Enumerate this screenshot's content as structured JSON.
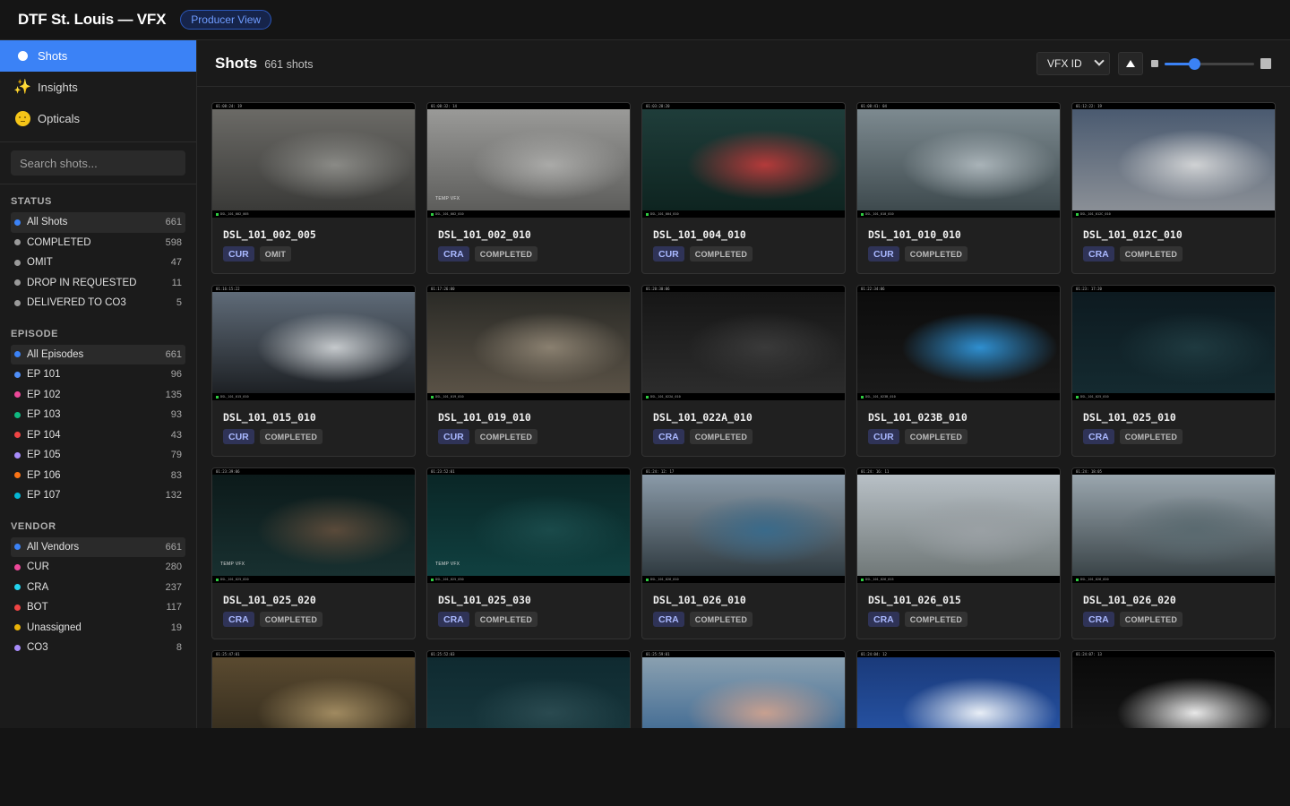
{
  "app": {
    "title": "DTF St. Louis — VFX",
    "view_badge": "Producer View"
  },
  "nav": [
    {
      "label": "Shots",
      "icon": "circle-icon",
      "active": true
    },
    {
      "label": "Insights",
      "icon": "sparkle-icon",
      "active": false
    },
    {
      "label": "Opticals",
      "icon": "face-icon",
      "active": false
    }
  ],
  "search": {
    "placeholder": "Search shots..."
  },
  "filters": {
    "status": {
      "title": "STATUS",
      "items": [
        {
          "label": "All Shots",
          "count": "661",
          "color": "#3b82f6",
          "selected": true
        },
        {
          "label": "COMPLETED",
          "count": "598",
          "color": "#9a9a9a"
        },
        {
          "label": "OMIT",
          "count": "47",
          "color": "#9a9a9a"
        },
        {
          "label": "DROP IN REQUESTED",
          "count": "11",
          "color": "#9a9a9a"
        },
        {
          "label": "DELIVERED TO CO3",
          "count": "5",
          "color": "#9a9a9a"
        }
      ]
    },
    "episode": {
      "title": "EPISODE",
      "items": [
        {
          "label": "All Episodes",
          "count": "661",
          "color": "#3b82f6",
          "selected": true
        },
        {
          "label": "EP 101",
          "count": "96",
          "color": "#4f8ef7"
        },
        {
          "label": "EP 102",
          "count": "135",
          "color": "#ec4899"
        },
        {
          "label": "EP 103",
          "count": "93",
          "color": "#10b981"
        },
        {
          "label": "EP 104",
          "count": "43",
          "color": "#ef4444"
        },
        {
          "label": "EP 105",
          "count": "79",
          "color": "#a78bfa"
        },
        {
          "label": "EP 106",
          "count": "83",
          "color": "#f97316"
        },
        {
          "label": "EP 107",
          "count": "132",
          "color": "#06b6d4"
        }
      ]
    },
    "vendor": {
      "title": "VENDOR",
      "items": [
        {
          "label": "All Vendors",
          "count": "661",
          "color": "#3b82f6",
          "selected": true
        },
        {
          "label": "CUR",
          "count": "280",
          "color": "#ec4899"
        },
        {
          "label": "CRA",
          "count": "237",
          "color": "#22d3ee"
        },
        {
          "label": "BOT",
          "count": "117",
          "color": "#ef4444"
        },
        {
          "label": "Unassigned",
          "count": "19",
          "color": "#eab308"
        },
        {
          "label": "CO3",
          "count": "8",
          "color": "#a78bfa"
        }
      ]
    }
  },
  "main": {
    "title": "Shots",
    "count_label": "661 shots",
    "sort": {
      "selected": "VFX ID"
    },
    "thumb_size": 0.33
  },
  "shots": [
    {
      "name": "DSL_101_002_005",
      "vendor": "CUR",
      "status": "OMIT",
      "tc": "01:08:24: 19",
      "bg": [
        "#6b6a66",
        "#3a3a38",
        "#8a8a86"
      ],
      "temp": false
    },
    {
      "name": "DSL_101_002_010",
      "vendor": "CRA",
      "status": "COMPLETED",
      "tc": "01:08:32: 14",
      "bg": [
        "#9a9a98",
        "#5d5d5b",
        "#aaaaa8"
      ],
      "temp": true
    },
    {
      "name": "DSL_101_004_010",
      "vendor": "CUR",
      "status": "COMPLETED",
      "tc": "01:03:28:20",
      "bg": [
        "#1f3d3a",
        "#0e2420",
        "#b43a3a"
      ],
      "temp": false
    },
    {
      "name": "DSL_101_010_010",
      "vendor": "CUR",
      "status": "COMPLETED",
      "tc": "01:08:41: 04",
      "bg": [
        "#7d8a90",
        "#3e4a4e",
        "#a9b3b8"
      ],
      "temp": false
    },
    {
      "name": "DSL_101_012C_010",
      "vendor": "CRA",
      "status": "COMPLETED",
      "tc": "01:12:22: 19",
      "bg": [
        "#4a5a70",
        "#8a8f96",
        "#d0d2d4"
      ],
      "temp": false
    },
    {
      "name": "DSL_101_015_010",
      "vendor": "CUR",
      "status": "COMPLETED",
      "tc": "01:16:15:22",
      "bg": [
        "#5f6b78",
        "#1d2024",
        "#c5c9cc"
      ],
      "temp": false
    },
    {
      "name": "DSL_101_019_010",
      "vendor": "CUR",
      "status": "COMPLETED",
      "tc": "01:17:26:00",
      "bg": [
        "#2a2a26",
        "#5a5246",
        "#8a8070"
      ],
      "temp": false
    },
    {
      "name": "DSL_101_022A_010",
      "vendor": "CRA",
      "status": "COMPLETED",
      "tc": "01:20:30:06",
      "bg": [
        "#161616",
        "#2c2c2c",
        "#3a3a3a"
      ],
      "temp": false
    },
    {
      "name": "DSL_101_023B_010",
      "vendor": "CUR",
      "status": "COMPLETED",
      "tc": "01:22:34:06",
      "bg": [
        "#0c0c0c",
        "#1a1a1a",
        "#2f8fd0"
      ],
      "temp": false
    },
    {
      "name": "DSL_101_025_010",
      "vendor": "CRA",
      "status": "COMPLETED",
      "tc": "01:23: 17:20",
      "bg": [
        "#0d1a20",
        "#142a30",
        "#1f3a40"
      ],
      "temp": false
    },
    {
      "name": "DSL_101_025_020",
      "vendor": "CRA",
      "status": "COMPLETED",
      "tc": "01:23:39:06",
      "bg": [
        "#0c1a1a",
        "#183030",
        "#5a4a3a"
      ],
      "temp": true
    },
    {
      "name": "DSL_101_025_030",
      "vendor": "CRA",
      "status": "COMPLETED",
      "tc": "01:23:52:01",
      "bg": [
        "#0a2626",
        "#104040",
        "#1a4a4a"
      ],
      "temp": true
    },
    {
      "name": "DSL_101_026_010",
      "vendor": "CRA",
      "status": "COMPLETED",
      "tc": "01:24: 12: 17",
      "bg": [
        "#8a9aa8",
        "#2f3a40",
        "#3a6a8a"
      ],
      "temp": false
    },
    {
      "name": "DSL_101_026_015",
      "vendor": "CRA",
      "status": "COMPLETED",
      "tc": "01:24: 16: 11",
      "bg": [
        "#b8c0c6",
        "#707878",
        "#9aa0a4"
      ],
      "temp": false
    },
    {
      "name": "DSL_101_026_020",
      "vendor": "CRA",
      "status": "COMPLETED",
      "tc": "01:24: 18:05",
      "bg": [
        "#9aa6ae",
        "#3a4448",
        "#5a6a70"
      ],
      "temp": false
    },
    {
      "name": "",
      "vendor": "",
      "status": "",
      "tc": "01:25:47:01",
      "bg": [
        "#5a4a30",
        "#2a2418",
        "#a08a60"
      ],
      "temp": false
    },
    {
      "name": "",
      "vendor": "",
      "status": "",
      "tc": "01:25:52:03",
      "bg": [
        "#0f2a30",
        "#1a3a40",
        "#2a4a50"
      ],
      "temp": false
    },
    {
      "name": "",
      "vendor": "",
      "status": "",
      "tc": "01:25:59:01",
      "bg": [
        "#8aa0b0",
        "#2a5a8a",
        "#c8a090"
      ],
      "temp": false
    },
    {
      "name": "",
      "vendor": "",
      "status": "",
      "tc": "01:24:04: 12",
      "bg": [
        "#1a3a7a",
        "#2a5ab0",
        "#e8eef6"
      ],
      "temp": false
    },
    {
      "name": "",
      "vendor": "",
      "status": "",
      "tc": "01:24:07: 13",
      "bg": [
        "#0a0a0a",
        "#1a1a1a",
        "#e8e8e8"
      ],
      "temp": false
    }
  ],
  "labels": {
    "temp_vfx": "TEMP VFX"
  }
}
